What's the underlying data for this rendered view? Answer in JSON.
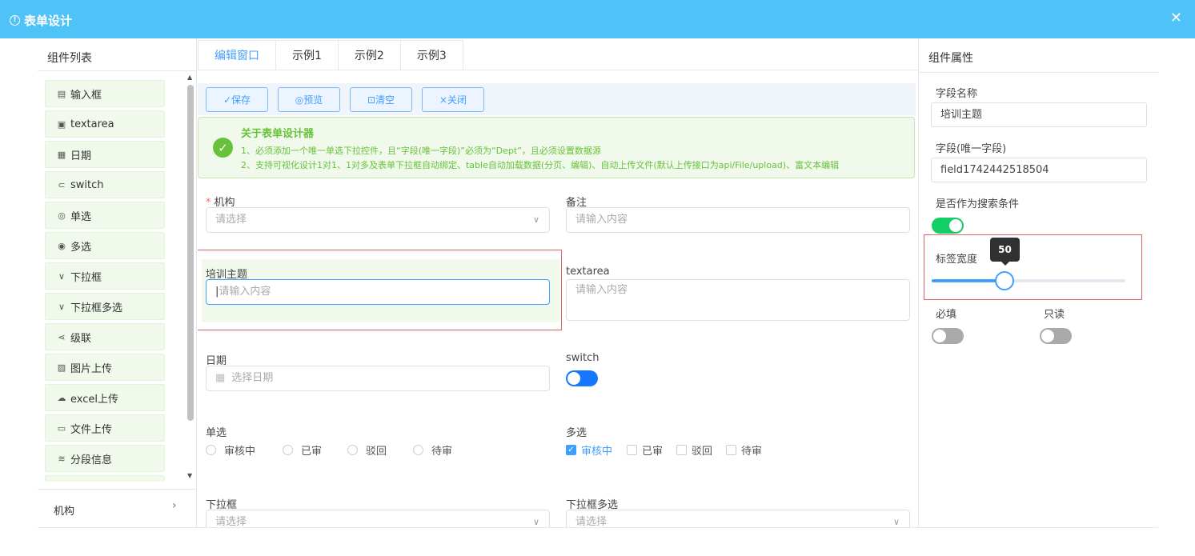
{
  "window": {
    "title": "表单设计"
  },
  "left": {
    "header": "组件列表",
    "components": [
      {
        "icon": "text-icon",
        "glyph": "▤",
        "label": "输入框"
      },
      {
        "icon": "textarea-icon",
        "glyph": "▣",
        "label": "textarea"
      },
      {
        "icon": "calendar-icon",
        "glyph": "▦",
        "label": "日期"
      },
      {
        "icon": "switch-icon",
        "glyph": "⊂",
        "label": "switch"
      },
      {
        "icon": "radio-icon",
        "glyph": "◎",
        "label": "单选"
      },
      {
        "icon": "checkbox-icon",
        "glyph": "◉",
        "label": "多选"
      },
      {
        "icon": "chevron-down-icon",
        "glyph": "∨",
        "label": "下拉框"
      },
      {
        "icon": "chevron-down-icon",
        "glyph": "∨",
        "label": "下拉框多选"
      },
      {
        "icon": "share-icon",
        "glyph": "⋖",
        "label": "级联"
      },
      {
        "icon": "image-icon",
        "glyph": "▨",
        "label": "图片上传"
      },
      {
        "icon": "cloud-upload-icon",
        "glyph": "☁",
        "label": "excel上传"
      },
      {
        "icon": "folder-icon",
        "glyph": "▭",
        "label": "文件上传"
      },
      {
        "icon": "section-icon",
        "glyph": "≋",
        "label": "分段信息"
      }
    ],
    "footer_item": "机构"
  },
  "tabs": [
    "编辑窗口",
    "示例1",
    "示例2",
    "示例3"
  ],
  "toolbar": {
    "save": "✓保存",
    "preview": "◎预览",
    "clear": "⊡清空",
    "close": "×关闭"
  },
  "alert": {
    "title": "关于表单设计器",
    "line1": "1、必须添加一个唯一单选下拉控件，且“字段(唯一字段)”必须为“Dept”，且必须设置数据源",
    "line2": "2、支持可视化设计1对1、1对多及表单下拉框自动绑定、table自动加载数据(分页、编辑)、自动上传文件(默认上传接口为api/File/upload)、富文本编辑"
  },
  "form": {
    "org": {
      "label": "机构",
      "placeholder": "请选择"
    },
    "remark": {
      "label": "备注",
      "placeholder": "请输入内容"
    },
    "topic": {
      "label": "培训主题",
      "placeholder": "请输入内容"
    },
    "textarea": {
      "label": "textarea",
      "placeholder": "请输入内容"
    },
    "date": {
      "label": "日期",
      "placeholder": "选择日期"
    },
    "switch": {
      "label": "switch"
    },
    "radio": {
      "label": "单选",
      "options": [
        "审核中",
        "已审",
        "驳回",
        "待审"
      ]
    },
    "checkbox": {
      "label": "多选",
      "options": [
        "审核中",
        "已审",
        "驳回",
        "待审"
      ],
      "checked": "审核中"
    },
    "select": {
      "label": "下拉框",
      "placeholder": "请选择"
    },
    "multiselect": {
      "label": "下拉框多选",
      "placeholder": "请选择"
    }
  },
  "props": {
    "header": "组件属性",
    "field_name_label": "字段名称",
    "field_name_value": "培训主题",
    "field_key_label": "字段(唯一字段)",
    "field_key_value": "field1742442518504",
    "search_label": "是否作为搜索条件",
    "label_width_label": "标签宽度",
    "label_width_value": "50",
    "required_label": "必填",
    "readonly_label": "只读"
  },
  "colors": {
    "accent": "#409eff",
    "success": "#67c23a",
    "titlebar": "#4fc3f7",
    "switch_on": "#13ce66"
  }
}
